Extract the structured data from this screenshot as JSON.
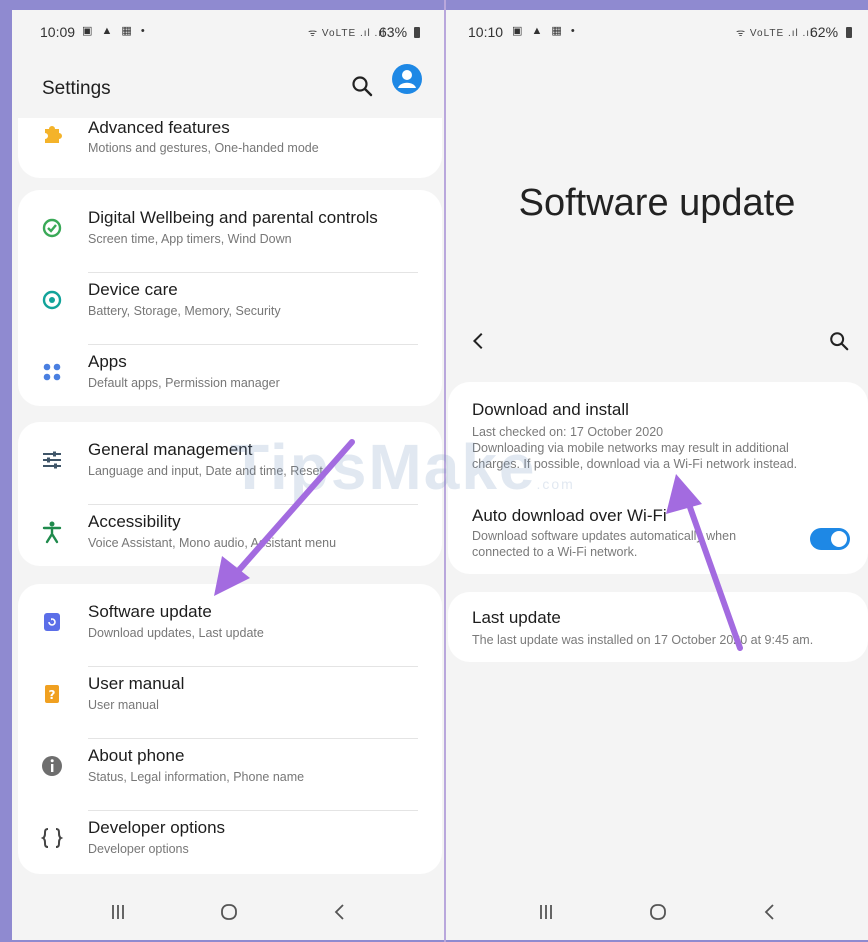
{
  "left": {
    "status": {
      "time": "10:09",
      "notif": "▣ ▲ ▦ •",
      "signal": "ᯤ VoLTE .ıl .ıl",
      "battery": "63%"
    },
    "header": {
      "title": "Settings"
    },
    "items": [
      {
        "title": "Advanced features",
        "subtitle": "Motions and gestures, One-handed mode"
      },
      {
        "title": "Digital Wellbeing and parental controls",
        "subtitle": "Screen time, App timers, Wind Down"
      },
      {
        "title": "Device care",
        "subtitle": "Battery, Storage, Memory, Security"
      },
      {
        "title": "Apps",
        "subtitle": "Default apps, Permission manager"
      },
      {
        "title": "General management",
        "subtitle": "Language and input, Date and time, Reset"
      },
      {
        "title": "Accessibility",
        "subtitle": "Voice Assistant, Mono audio, Assistant menu"
      },
      {
        "title": "Software update",
        "subtitle": "Download updates, Last update"
      },
      {
        "title": "User manual",
        "subtitle": "User manual"
      },
      {
        "title": "About phone",
        "subtitle": "Status, Legal information, Phone name"
      },
      {
        "title": "Developer options",
        "subtitle": "Developer options"
      }
    ]
  },
  "right": {
    "status": {
      "time": "10:10",
      "notif": "▣ ▲ ▦ •",
      "signal": "ᯤ VoLTE .ıl .ıl",
      "battery": "62%"
    },
    "title": "Software update",
    "download": {
      "title": "Download and install",
      "checked": "Last checked on: 17 October 2020",
      "note1": "Downloading via mobile networks may result in additional",
      "note2": "charges. If possible, download via a Wi-Fi network instead."
    },
    "auto": {
      "title": "Auto download over Wi-Fi",
      "sub1": "Download software updates automatically when",
      "sub2": "connected to a Wi-Fi network.",
      "enabled": true
    },
    "last": {
      "title": "Last update",
      "sub": "The last update was installed on 17 October 2020 at 9:45 am."
    }
  },
  "watermark": {
    "text": "TipsMake",
    "suffix": ".com"
  },
  "colors": {
    "accent": "#1e88e5",
    "arrow": "#a36be0",
    "frame": "#8f8ad0"
  }
}
